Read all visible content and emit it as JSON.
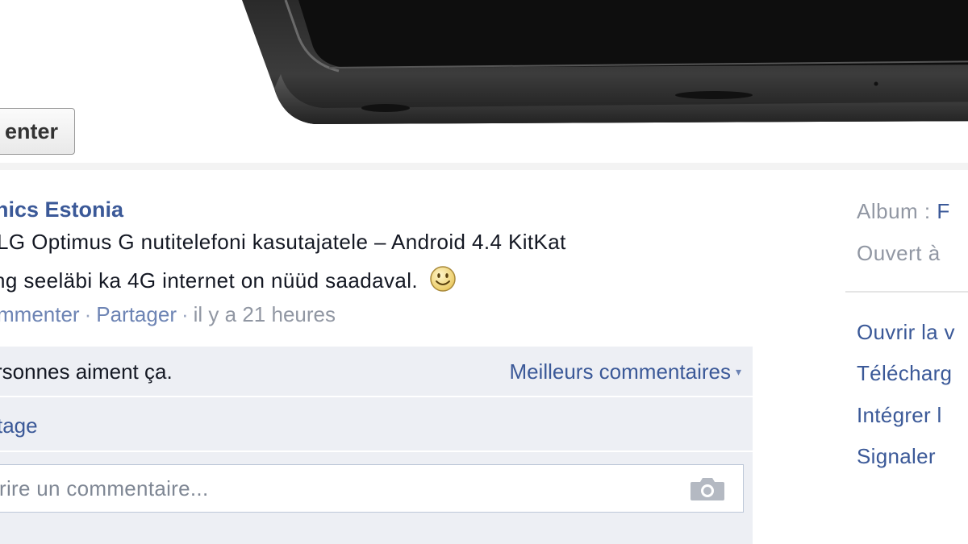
{
  "photo": {
    "comment_button_label": "enter"
  },
  "post": {
    "author": "nics Estonia",
    "message_line1": "LG Optimus G nutitelefoni kasutajatele – Android 4.4 KitKat",
    "message_line2": "ng seeläbi ka 4G internet on nüüd saadaval.",
    "emoji_icon": "smiley-icon",
    "actions": {
      "comment": "mmenter",
      "share": "Partager",
      "separator": "·",
      "time": "il y a 21 heures"
    }
  },
  "ufi": {
    "likes_text": "rsonnes aiment ça.",
    "best_comments": "Meilleurs commentaires",
    "best_comments_caret": "▾",
    "shares_text": "tage",
    "comment_placeholder": "rire un commentaire...",
    "camera_icon": "camera-icon"
  },
  "sidebar": {
    "album_label": "Album :",
    "album_value": "F",
    "visibility_label": "Ouvert à",
    "links": [
      "Ouvrir la v",
      "Télécharg",
      "Intégrer l",
      "Signaler"
    ]
  },
  "colors": {
    "link": "#3b5998",
    "muted": "#9197a3",
    "ufi_bg": "#edeff4"
  }
}
